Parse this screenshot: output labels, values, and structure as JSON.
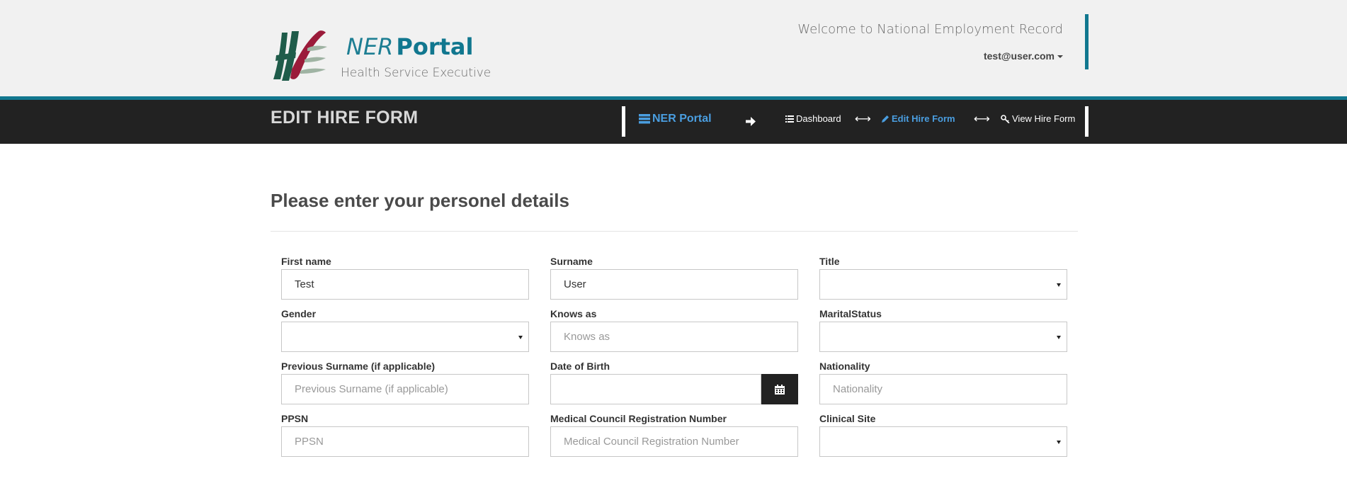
{
  "header": {
    "brand_ner": "NER",
    "brand_portal": "Portal",
    "brand_subtitle": "Health Service Executive",
    "welcome": "Welcome to National Employment Record",
    "user_email": "test@user.com",
    "colors": {
      "teal": "#11778f",
      "dark_bar": "#222222",
      "link_blue": "#4a9ee0"
    }
  },
  "navbar": {
    "page_heading": "EDIT HIRE FORM",
    "home_label": "NER Portal",
    "dashboard_label": "Dashboard",
    "edit_label": "Edit Hire Form",
    "view_label": "View Hire Form"
  },
  "form": {
    "section_title": "Please enter your personel details",
    "first_name": {
      "label": "First name",
      "value": "Test"
    },
    "surname": {
      "label": "Surname",
      "value": "User"
    },
    "title": {
      "label": "Title",
      "value": ""
    },
    "gender": {
      "label": "Gender",
      "value": ""
    },
    "known_as": {
      "label": "Knows as",
      "placeholder": "Knows as"
    },
    "marital_status": {
      "label": "MaritalStatus",
      "value": ""
    },
    "previous_surname": {
      "label": "Previous Surname (if applicable)",
      "placeholder": "Previous Surname (if applicable)"
    },
    "dob": {
      "label": "Date of Birth",
      "value": ""
    },
    "nationality": {
      "label": "Nationality",
      "placeholder": "Nationality"
    },
    "ppsn": {
      "label": "PPSN",
      "placeholder": "PPSN"
    },
    "mcrn": {
      "label": "Medical Council Registration Number",
      "placeholder": "Medical Council Registration Number"
    },
    "clinical_site": {
      "label": "Clinical Site",
      "value": ""
    }
  }
}
